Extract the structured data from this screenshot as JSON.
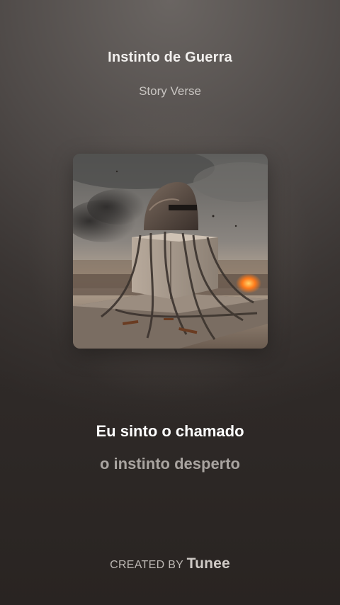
{
  "song": {
    "title": "Instinto de Guerra",
    "artist": "Story Verse"
  },
  "cover": {
    "name": "cover-art-helmet-chains"
  },
  "lyrics": {
    "current": "Eu sinto o chamado",
    "next": "o instinto desperto"
  },
  "footer": {
    "created_by": "CREATED BY",
    "brand": "Tunee"
  },
  "colors": {
    "background_top": "#6a6562",
    "background_bottom": "#2f2a28",
    "title": "#f2f0ee",
    "subtitle": "#c9c5c2",
    "lyric_current": "#ffffff",
    "lyric_next": "#a9a4a0"
  }
}
